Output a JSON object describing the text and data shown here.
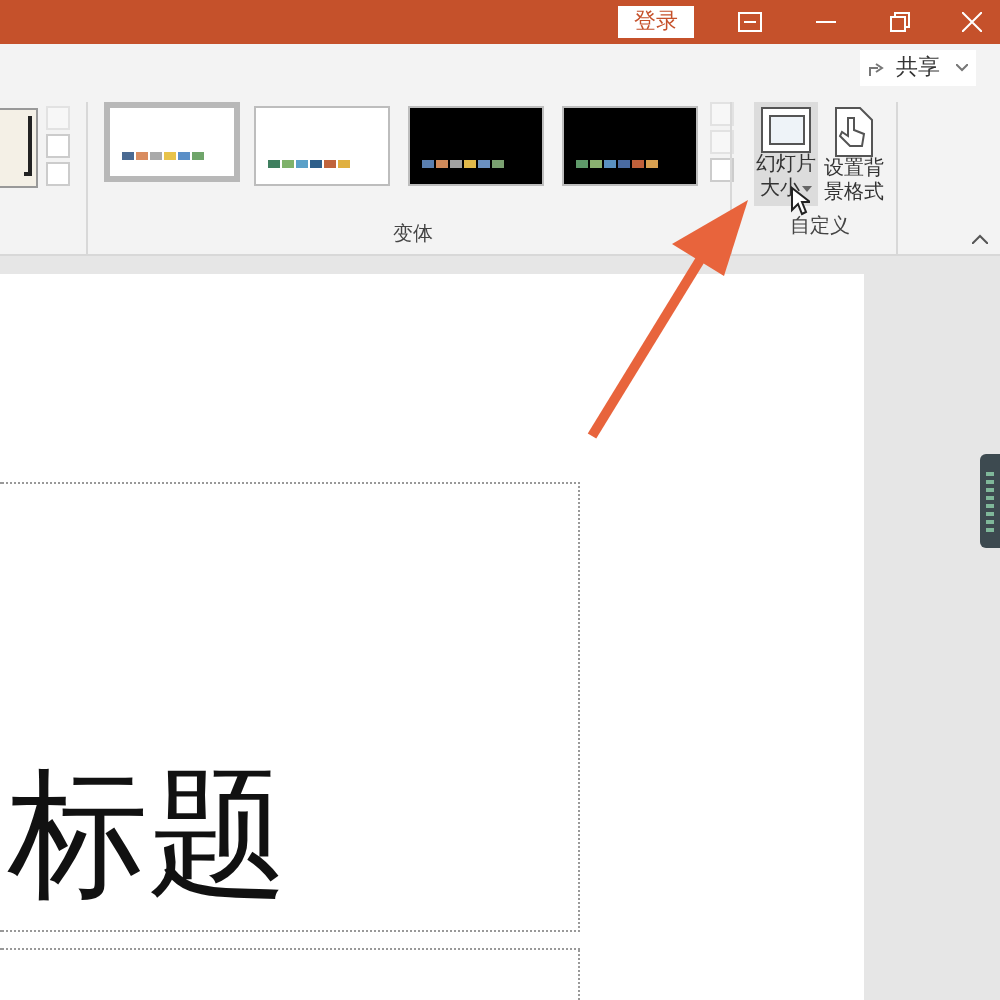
{
  "title_bar": {
    "login_button": "登录"
  },
  "ribbon": {
    "share_button": "共享",
    "variants": {
      "label": "变体",
      "items": [
        {
          "selected": true,
          "dark": false,
          "swatches": [
            {
              "color": "#4a6a92"
            },
            {
              "color": "#d98c5f"
            },
            {
              "color": "#a9a9a9"
            },
            {
              "color": "#e8c34a"
            },
            {
              "color": "#5b8fc7"
            },
            {
              "color": "#6fa56a"
            }
          ]
        },
        {
          "selected": false,
          "dark": false,
          "swatches": [
            {
              "color": "#3f7f5f"
            },
            {
              "color": "#7fb26a"
            },
            {
              "color": "#5aa0c8"
            },
            {
              "color": "#2e5f8a"
            },
            {
              "color": "#c0643c"
            },
            {
              "color": "#e0b040"
            }
          ]
        },
        {
          "selected": false,
          "dark": true,
          "swatches": [
            {
              "color": "#5a7fb0"
            },
            {
              "color": "#d08a5a"
            },
            {
              "color": "#a0a0a0"
            },
            {
              "color": "#e0b84a"
            },
            {
              "color": "#6a90c0"
            },
            {
              "color": "#7aa070"
            }
          ]
        },
        {
          "selected": false,
          "dark": true,
          "swatches": [
            {
              "color": "#5f9a6a"
            },
            {
              "color": "#8ab070"
            },
            {
              "color": "#5a90c0"
            },
            {
              "color": "#4a6aa0"
            },
            {
              "color": "#c0603a"
            },
            {
              "color": "#d8a050"
            }
          ]
        }
      ]
    },
    "customize": {
      "label": "自定义",
      "buttons": [
        {
          "kind": "slide-size",
          "label_lines": [
            "幻灯片",
            "大小"
          ],
          "highlighted": true,
          "dropdown": true
        },
        {
          "kind": "format-background",
          "label_lines": [
            "设置背",
            "景格式"
          ],
          "highlighted": false,
          "dropdown": false
        }
      ]
    }
  },
  "slide": {
    "title": "标题"
  }
}
